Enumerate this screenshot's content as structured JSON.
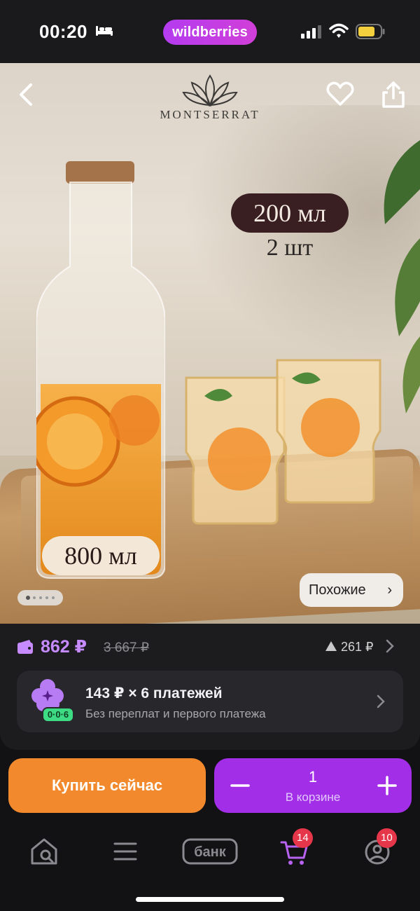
{
  "status_bar": {
    "time": "00:20",
    "app_pill": "wildberries",
    "battery_color": "#f4d03f"
  },
  "hero": {
    "brand_name": "MONTSERRAT",
    "tag_volume_small": "200 мл",
    "tag_count": "2 шт",
    "tag_volume_large": "800 мл",
    "similar_label": "Похожие",
    "slides_total": 5,
    "slide_active": 1
  },
  "price": {
    "current": "862 ₽",
    "old": "3 667 ₽",
    "delta": "261 ₽",
    "accent_color": "#c58bff"
  },
  "installment": {
    "title": "143 ₽ × 6 платежей",
    "subtitle": "Без переплат и первого платежа",
    "badge": "0·0·6"
  },
  "actions": {
    "buy_now": "Купить сейчас",
    "quantity": "1",
    "in_cart_label": "В корзине",
    "buy_color": "#f28a2d",
    "cart_color": "#a32ee8"
  },
  "tabbar": {
    "bank_label": "банк",
    "cart_badge": "14",
    "profile_badge": "10"
  }
}
